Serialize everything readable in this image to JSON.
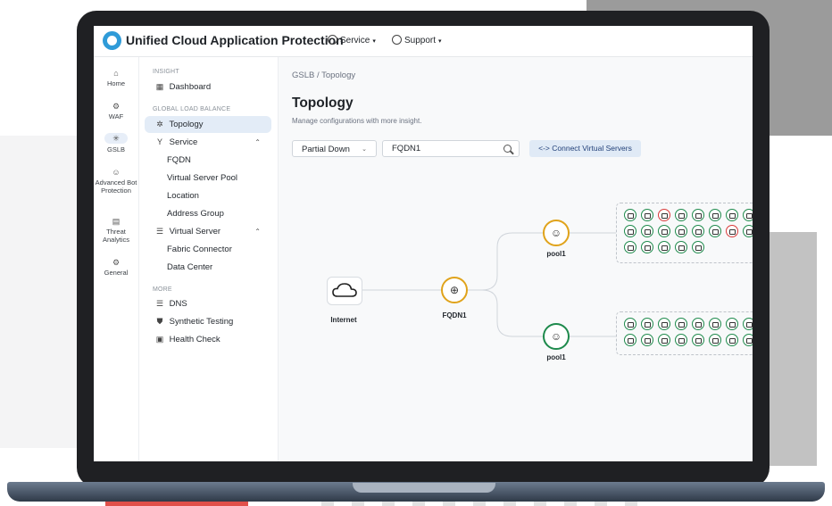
{
  "app": {
    "title": "Unified Cloud Application Protection",
    "menus": [
      {
        "label": "Service",
        "icon": "service-icon"
      },
      {
        "label": "Support",
        "icon": "support-icon"
      }
    ]
  },
  "rail": [
    {
      "label": "Home",
      "icon": "home-icon"
    },
    {
      "label": "WAF",
      "icon": "waf-icon"
    },
    {
      "label": "GSLB",
      "icon": "gslb-icon",
      "active": true
    },
    {
      "label": "Advanced Bot Protection",
      "icon": "bot-icon"
    },
    {
      "label": "Threat Analytics",
      "icon": "analytics-icon"
    },
    {
      "label": "General",
      "icon": "gear-icon"
    }
  ],
  "sidebar": {
    "sections": {
      "insight": "INSIGHT",
      "global": "GLOBAL LOAD BALANCE",
      "more": "MORE"
    },
    "items": {
      "dashboard": "Dashboard",
      "topology": "Topology",
      "service": "Service",
      "fqdn": "FQDN",
      "pool": "Virtual Server Pool",
      "location": "Location",
      "address_group": "Address Group",
      "virtual_server": "Virtual Server",
      "fabric": "Fabric Connector",
      "datacenter": "Data Center",
      "dns": "DNS",
      "synthetic": "Synthetic Testing",
      "health": "Health Check"
    }
  },
  "main": {
    "breadcrumb": "GSLB / Topology",
    "title": "Topology",
    "subtitle": "Manage configurations with more insight.",
    "filter_value": "Partial Down",
    "search_value": "FQDN1",
    "connect_button": "<-> Connect Virtual Servers"
  },
  "topology": {
    "nodes": {
      "internet": "Internet",
      "fqdn": "FQDN1",
      "pool_a": "pool1",
      "pool_b": "pool1"
    },
    "status_colors": {
      "partial": "#e0a31b",
      "healthy": "#1e8a4c",
      "down": "#d83a3a"
    },
    "pool_a_servers": [
      [
        "up",
        "up",
        "down",
        "up",
        "up",
        "up",
        "up",
        "up"
      ],
      [
        "up",
        "up",
        "up",
        "up",
        "up",
        "up",
        "down",
        "up"
      ],
      [
        "up",
        "up",
        "up",
        "up",
        "up"
      ]
    ],
    "pool_b_servers": [
      [
        "up",
        "up",
        "up",
        "up",
        "up",
        "up",
        "up",
        "up"
      ],
      [
        "up",
        "up",
        "up",
        "up",
        "up",
        "up",
        "up",
        "up"
      ]
    ]
  }
}
